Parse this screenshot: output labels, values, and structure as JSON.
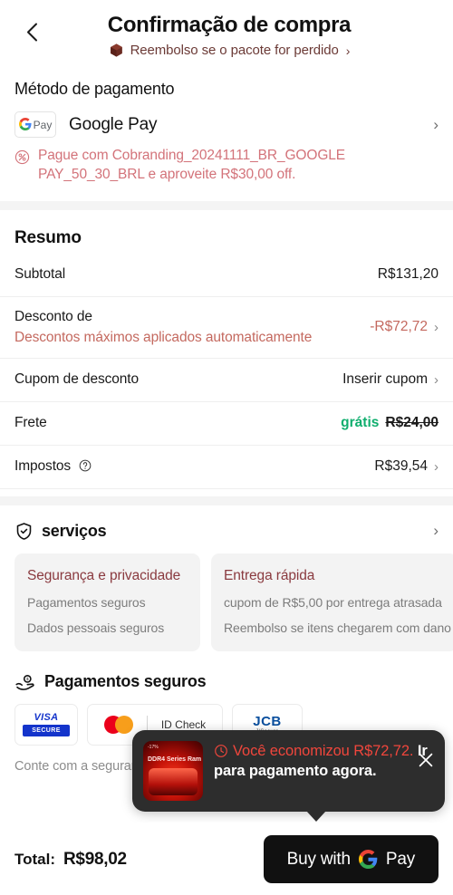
{
  "header": {
    "back_icon": "chevron-left-icon",
    "title": "Confirmação de compra",
    "subtitle": "Reembolso se o pacote for perdido",
    "subtitle_chevron": "›",
    "box_icon": "package-box-icon"
  },
  "payment": {
    "section_title": "Método de pagamento",
    "badge_g": "G",
    "badge_pay": "Pay",
    "method_name": "Google Pay",
    "chevron": "›",
    "promo_icon": "percent-circle-icon",
    "promo_text": "Pague com Cobranding_20241111_BR_GOOGLE PAY_50_30_BRL e aproveite R$30,00 off."
  },
  "summary": {
    "heading": "Resumo",
    "rows": [
      {
        "label": "Subtotal",
        "value": "R$131,20",
        "chevron": "",
        "sublabel": "",
        "accent": false
      },
      {
        "label": "Desconto de",
        "sublabel": "Descontos máximos aplicados automaticamente",
        "value": "-R$72,72",
        "chevron": "›",
        "accent": true
      },
      {
        "label": "Cupom de desconto",
        "value": "Inserir cupom",
        "chevron": "›",
        "sublabel": "",
        "accent": false
      },
      {
        "label": "Frete",
        "value_free": "grátis",
        "value_struck": "R$24,00",
        "chevron": "",
        "sublabel": "",
        "accent": false
      },
      {
        "label": "Impostos",
        "info_icon": "question-circle-icon",
        "value": "R$39,54",
        "chevron": "›",
        "sublabel": "",
        "accent": false
      }
    ]
  },
  "services": {
    "icon": "shield-check-icon",
    "title": "serviços",
    "chevron": "›",
    "cards": [
      {
        "title": "Segurança e privacidade",
        "lines": [
          "Pagamentos seguros",
          "Dados pessoais seguros"
        ]
      },
      {
        "title": "Entrega rápida",
        "lines": [
          "cupom de R$5,00 por entrega atrasada",
          "Reembolso se itens chegarem com dano"
        ]
      }
    ]
  },
  "secure": {
    "icon": "hand-coin-icon",
    "title": "Pagamentos seguros",
    "logos": [
      {
        "name": "visa-secure-logo",
        "primary": "VISA",
        "secondary": "SECURE"
      },
      {
        "name": "mastercard-idcheck-logo",
        "primary": "",
        "secondary": "ID Check"
      },
      {
        "name": "jcb-jsecure-logo",
        "primary": "JCB",
        "secondary": "J/Secure"
      }
    ],
    "note": "Conte com a segurança dos seus dados, garantida por nossos"
  },
  "toast": {
    "clock_icon": "clock-icon",
    "close_icon": "close-icon",
    "thumb_badge": "-17%",
    "thumb_name": "DDR4 Series Ram",
    "saved_label": "Você economizou",
    "saved_amount": "R$72,72.",
    "cta": "Ir para pagamento agora."
  },
  "footer": {
    "total_label": "Total:",
    "total_value": "R$98,02",
    "buy_text": "Buy with",
    "buy_pay": "Pay",
    "google_g": "G"
  },
  "colors": {
    "accent_red": "#c4695f",
    "promo_pink": "#d3737a",
    "green": "#0fae6e",
    "toast_bg": "#2d2d2d",
    "toast_red": "#f0463c",
    "dark": "#121212"
  }
}
